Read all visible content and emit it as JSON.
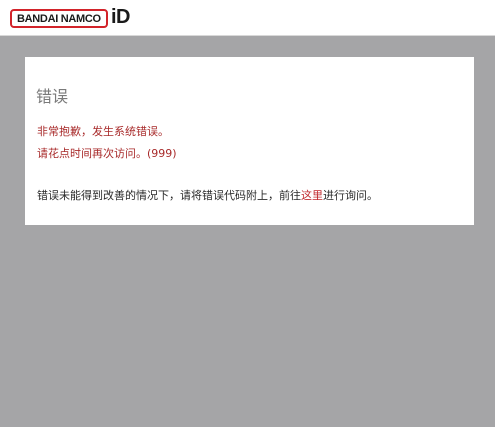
{
  "header": {
    "logo_text": "BANDAI NAMCO",
    "logo_id": "iD",
    "brand_color": "#d2232a"
  },
  "error": {
    "title": "错误",
    "message_line1": "非常抱歉，发生系统错误。",
    "message_line2": "请花点时间再次访问。",
    "code": "(999)",
    "help_prefix": "错误未能得到改善的情况下，请将错误代码附上，前往",
    "help_link": "这里",
    "help_suffix": "进行询问。",
    "error_color": "#a82a2a",
    "link_color": "#c0282d"
  }
}
